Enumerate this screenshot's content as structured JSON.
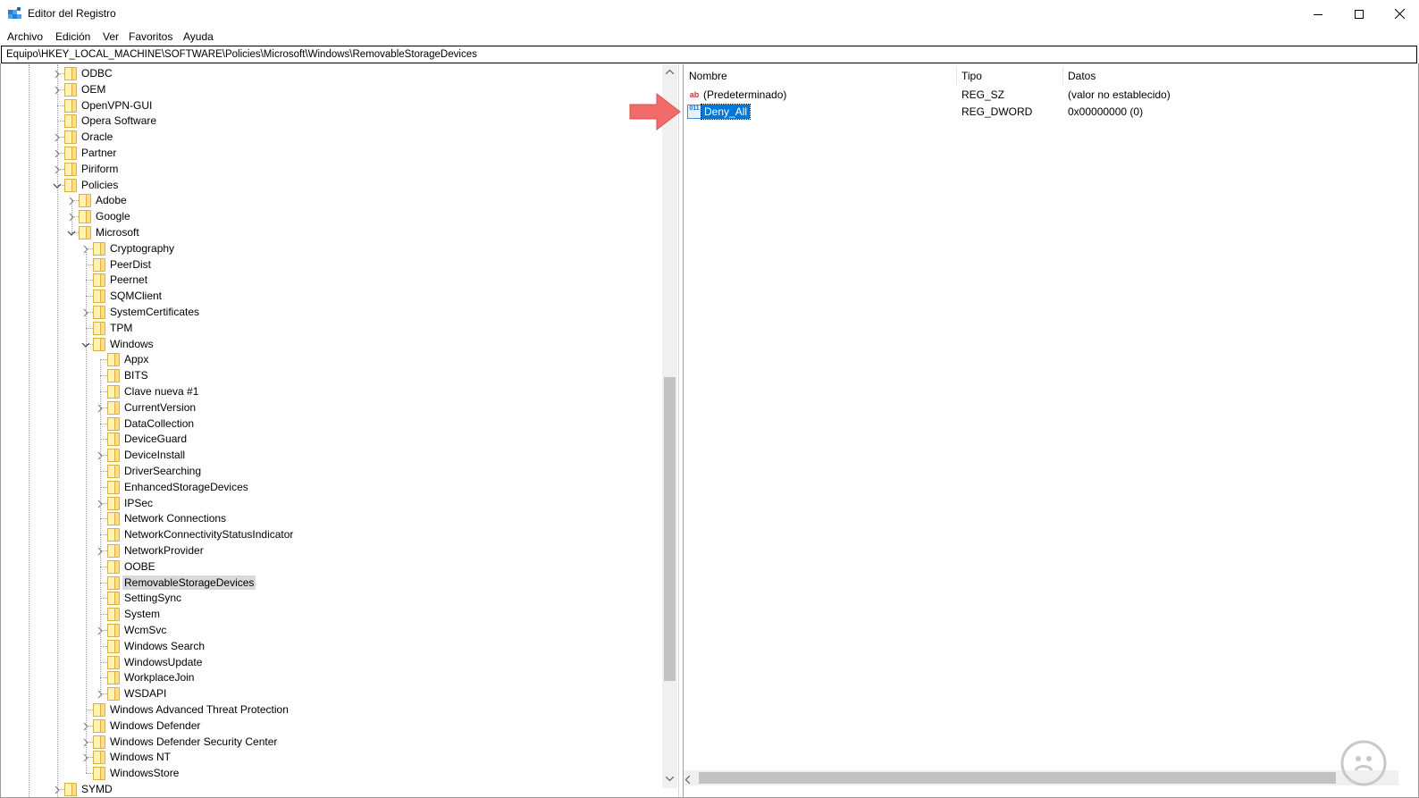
{
  "window": {
    "title": "Editor del Registro"
  },
  "menu": [
    "Archivo",
    "Edición",
    "Ver",
    "Favoritos",
    "Ayuda"
  ],
  "address": "Equipo\\HKEY_LOCAL_MACHINE\\SOFTWARE\\Policies\\Microsoft\\Windows\\RemovableStorageDevices",
  "tree": {
    "items": [
      {
        "label": "ODBC",
        "level": 1,
        "expander": "collapsed"
      },
      {
        "label": "OEM",
        "level": 1,
        "expander": "collapsed"
      },
      {
        "label": "OpenVPN-GUI",
        "level": 1,
        "expander": "none"
      },
      {
        "label": "Opera Software",
        "level": 1,
        "expander": "none"
      },
      {
        "label": "Oracle",
        "level": 1,
        "expander": "collapsed"
      },
      {
        "label": "Partner",
        "level": 1,
        "expander": "collapsed"
      },
      {
        "label": "Piriform",
        "level": 1,
        "expander": "collapsed"
      },
      {
        "label": "Policies",
        "level": 1,
        "expander": "expanded"
      },
      {
        "label": "Adobe",
        "level": 2,
        "expander": "collapsed"
      },
      {
        "label": "Google",
        "level": 2,
        "expander": "collapsed"
      },
      {
        "label": "Microsoft",
        "level": 2,
        "expander": "expanded"
      },
      {
        "label": "Cryptography",
        "level": 3,
        "expander": "collapsed"
      },
      {
        "label": "PeerDist",
        "level": 3,
        "expander": "none"
      },
      {
        "label": "Peernet",
        "level": 3,
        "expander": "none"
      },
      {
        "label": "SQMClient",
        "level": 3,
        "expander": "none"
      },
      {
        "label": "SystemCertificates",
        "level": 3,
        "expander": "collapsed"
      },
      {
        "label": "TPM",
        "level": 3,
        "expander": "none"
      },
      {
        "label": "Windows",
        "level": 3,
        "expander": "expanded"
      },
      {
        "label": "Appx",
        "level": 4,
        "expander": "none"
      },
      {
        "label": "BITS",
        "level": 4,
        "expander": "none"
      },
      {
        "label": "Clave nueva #1",
        "level": 4,
        "expander": "none"
      },
      {
        "label": "CurrentVersion",
        "level": 4,
        "expander": "collapsed"
      },
      {
        "label": "DataCollection",
        "level": 4,
        "expander": "none"
      },
      {
        "label": "DeviceGuard",
        "level": 4,
        "expander": "none"
      },
      {
        "label": "DeviceInstall",
        "level": 4,
        "expander": "collapsed"
      },
      {
        "label": "DriverSearching",
        "level": 4,
        "expander": "none"
      },
      {
        "label": "EnhancedStorageDevices",
        "level": 4,
        "expander": "none"
      },
      {
        "label": "IPSec",
        "level": 4,
        "expander": "collapsed"
      },
      {
        "label": "Network Connections",
        "level": 4,
        "expander": "none"
      },
      {
        "label": "NetworkConnectivityStatusIndicator",
        "level": 4,
        "expander": "none"
      },
      {
        "label": "NetworkProvider",
        "level": 4,
        "expander": "collapsed"
      },
      {
        "label": "OOBE",
        "level": 4,
        "expander": "none"
      },
      {
        "label": "RemovableStorageDevices",
        "level": 4,
        "expander": "none",
        "selected": true
      },
      {
        "label": "SettingSync",
        "level": 4,
        "expander": "none"
      },
      {
        "label": "System",
        "level": 4,
        "expander": "none"
      },
      {
        "label": "WcmSvc",
        "level": 4,
        "expander": "collapsed"
      },
      {
        "label": "Windows Search",
        "level": 4,
        "expander": "none"
      },
      {
        "label": "WindowsUpdate",
        "level": 4,
        "expander": "none"
      },
      {
        "label": "WorkplaceJoin",
        "level": 4,
        "expander": "none"
      },
      {
        "label": "WSDAPI",
        "level": 4,
        "expander": "collapsed"
      },
      {
        "label": "Windows Advanced Threat Protection",
        "level": 3,
        "expander": "none"
      },
      {
        "label": "Windows Defender",
        "level": 3,
        "expander": "collapsed"
      },
      {
        "label": "Windows Defender Security Center",
        "level": 3,
        "expander": "collapsed"
      },
      {
        "label": "Windows NT",
        "level": 3,
        "expander": "collapsed"
      },
      {
        "label": "WindowsStore",
        "level": 3,
        "expander": "none"
      },
      {
        "label": "SYMD",
        "level": 1,
        "expander": "collapsed"
      }
    ]
  },
  "list": {
    "columns": [
      "Nombre",
      "Tipo",
      "Datos"
    ],
    "rows": [
      {
        "name": "(Predeterminado)",
        "type": "REG_SZ",
        "data": "(valor no establecido)",
        "icon": "ab"
      },
      {
        "name": "Deny_All",
        "type": "REG_DWORD",
        "data": "0x00000000 (0)",
        "icon": "011",
        "selected": true
      }
    ]
  },
  "colors": {
    "selection": "#0078d7",
    "folder": "#ffe07a",
    "arrow": "#f26b6b"
  }
}
